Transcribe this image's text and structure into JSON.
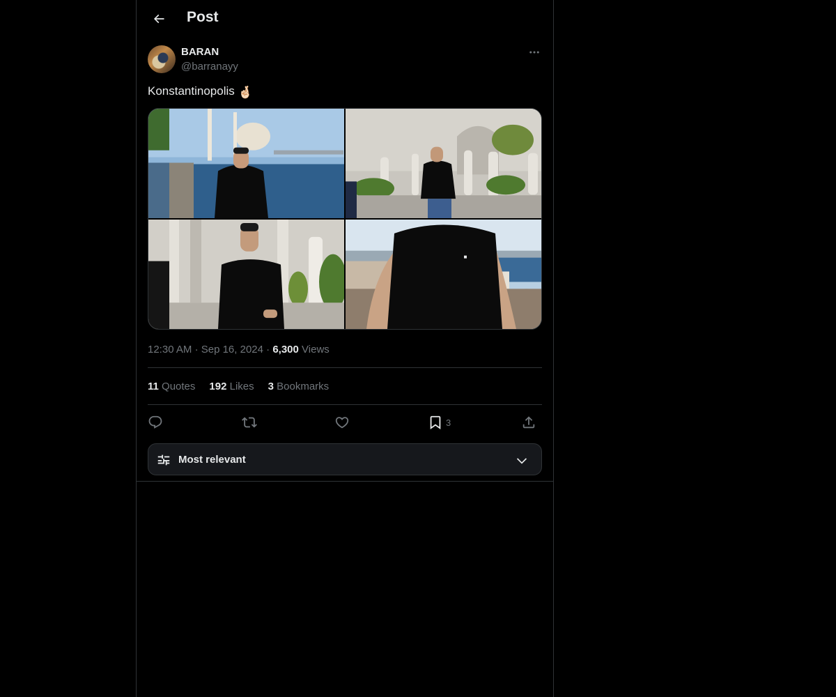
{
  "header": {
    "title": "Post"
  },
  "author": {
    "display_name": "BARAN",
    "handle": "@barranayy"
  },
  "post": {
    "text": "Konstantinopolis",
    "emoji": "🤞🏻",
    "time": "12:30 AM",
    "separator": "·",
    "date": "Sep 16, 2024",
    "views_count": "6,300",
    "views_label": "Views"
  },
  "stats": {
    "quotes_count": "11",
    "quotes_label": "Quotes",
    "likes_count": "192",
    "likes_label": "Likes",
    "bookmarks_count": "3",
    "bookmarks_label": "Bookmarks"
  },
  "actions": {
    "bookmark_count": "3"
  },
  "sort": {
    "label": "Most relevant"
  },
  "colors": {
    "background": "#000000",
    "text": "#e7e9ea",
    "muted": "#71767b",
    "border": "#2f3336"
  },
  "icons": [
    "arrow-left-icon",
    "more-icon",
    "reply-icon",
    "retweet-icon",
    "heart-icon",
    "bookmark-icon",
    "share-icon",
    "sliders-icon",
    "chevron-down-icon"
  ]
}
